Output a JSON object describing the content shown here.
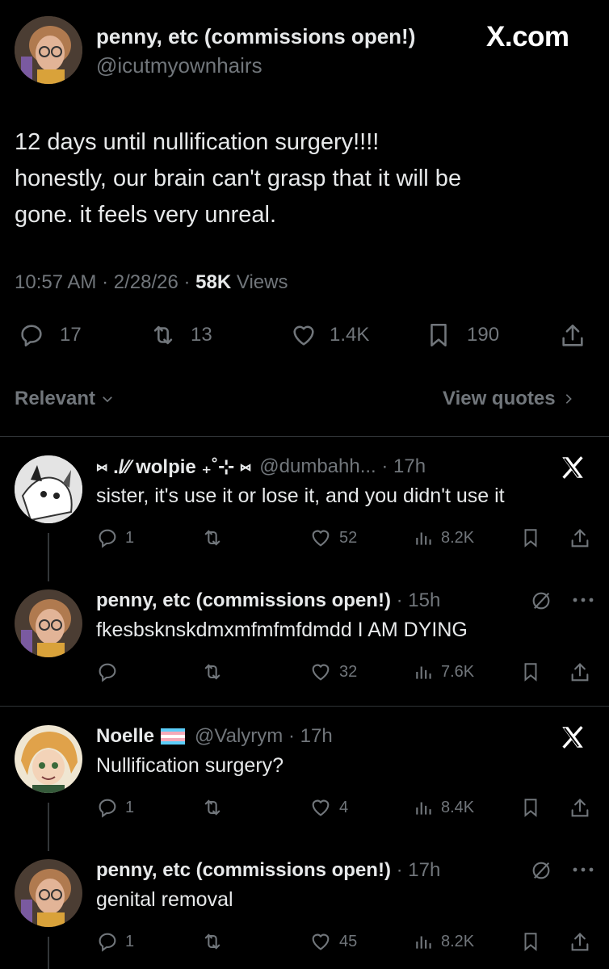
{
  "header": {
    "display_name": "penny, etc (commissions open!)",
    "handle": "@icutmyownhairs",
    "site_label": "X.com"
  },
  "tweet": {
    "lines": [
      "12 days until nullification surgery!!!!",
      "honestly, our brain can't grasp that it will be",
      "gone. it feels very unreal."
    ],
    "time": "10:57 AM",
    "date": "2/28/26",
    "views_count": "58K",
    "views_label": "Views",
    "replies": "17",
    "reposts": "13",
    "likes": "1.4K",
    "bookmarks": "190"
  },
  "filters": {
    "sort_label": "Relevant",
    "quotes_label": "View quotes"
  },
  "replies": [
    {
      "name": "⑅ ./∕∕ wolpie ₊˚⊹ ⑅",
      "handle": "@dumbahh...",
      "time": "17h",
      "text": "sister, it's use it or lose it, and you didn't use it",
      "reply_count": "1",
      "likes": "52",
      "views": "8.2K"
    },
    {
      "name": "penny, etc (commissions open!)",
      "handle": "",
      "time": "15h",
      "text": "fkesbsknskdmxmfmfmfdmdd I AM DYING",
      "reply_count": "",
      "likes": "32",
      "views": "7.6K"
    },
    {
      "name": "Noelle",
      "handle": "@Valyrym",
      "time": "17h",
      "text": "Nullification surgery?",
      "reply_count": "1",
      "likes": "4",
      "views": "8.4K"
    },
    {
      "name": "penny, etc (commissions open!)",
      "handle": "",
      "time": "17h",
      "text": "genital removal",
      "reply_count": "1",
      "likes": "45",
      "views": "8.2K"
    }
  ],
  "colors": {
    "background": "#000000",
    "text": "#e7e9ea",
    "muted": "#71767b",
    "divider": "#2f3336",
    "trans_flag_blue": "#5bcefa",
    "trans_flag_pink": "#f5a9b8"
  }
}
